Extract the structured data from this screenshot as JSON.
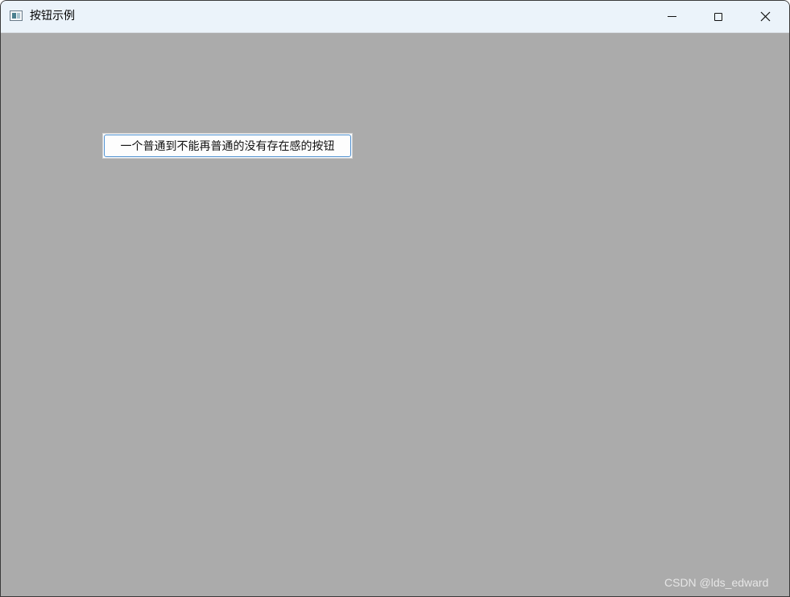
{
  "window": {
    "title": "按钮示例",
    "icons": {
      "app": "app-window-icon",
      "minimize": "minimize-icon",
      "maximize": "maximize-icon",
      "close": "close-icon"
    }
  },
  "client": {
    "background": "#ababab",
    "button_label": "一个普通到不能再普通的没有存在感的按钮"
  },
  "watermark": "CSDN @lds_edward"
}
